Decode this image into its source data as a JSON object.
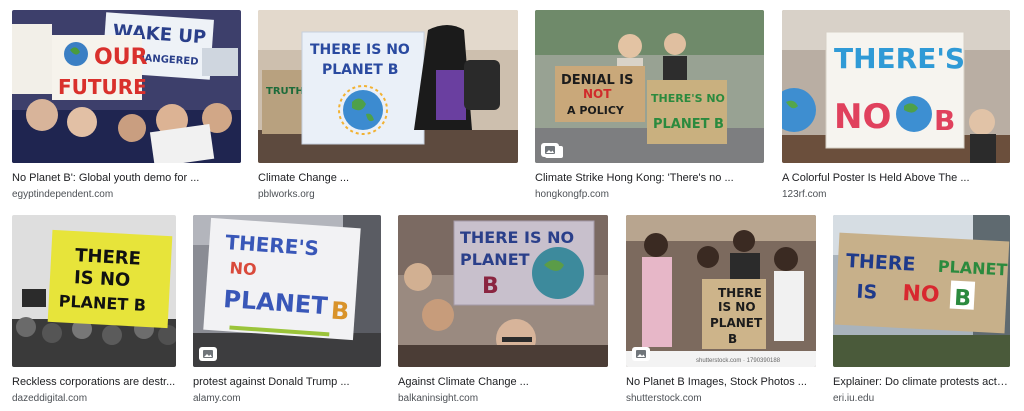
{
  "results": [
    {
      "title": "No Planet B': Global youth demo for ...",
      "source": "egyptindependent.com",
      "sign_lines": [
        "WAKE UP",
        "OUR",
        "FUTURE"
      ],
      "photo_bg": "#3d3f6b",
      "sign_color": "#f4f1ea",
      "text_color": "#d9302c",
      "icon": "image-icon"
    },
    {
      "title": "Climate Change ...",
      "source": "pblworks.org",
      "sign_lines": [
        "THERE IS NO",
        "PLANET B"
      ],
      "photo_bg": "#c9b9a6",
      "sign_color": "#eaf0f8",
      "text_color": "#2a4aa0",
      "icon": "image-icon"
    },
    {
      "title": "Climate Strike Hong Kong: 'There's no ...",
      "source": "hongkongfp.com",
      "sign_lines": [
        "DENIAL IS",
        "NOT",
        "A POLICY",
        "THERE'S NO",
        "PLANET B"
      ],
      "photo_bg": "#8f9a8a",
      "sign_color": "#c9a87a",
      "text_color": "#1c1c1c",
      "icon": "image-icon"
    },
    {
      "title": "A Colorful Poster Is Held Above The ...",
      "source": "123rf.com",
      "sign_lines": [
        "THERE'S",
        "NO",
        "B"
      ],
      "photo_bg": "#b9aea3",
      "sign_color": "#f6f4ef",
      "text_color": "#e0415d",
      "icon": "image-icon"
    },
    {
      "title": "Reckless corporations are destr...",
      "source": "dazeddigital.com",
      "sign_lines": [
        "THERE",
        "IS NO",
        "PLANET B"
      ],
      "photo_bg": "#d9d9d9",
      "sign_color": "#e7e43a",
      "text_color": "#111111",
      "icon": "image-icon"
    },
    {
      "title": "protest against Donald Trump ...",
      "source": "alamy.com",
      "sign_lines": [
        "THERE'S",
        "NO",
        "PLANET",
        "B"
      ],
      "photo_bg": "#8a8c94",
      "sign_color": "#f2f2f4",
      "text_color": "#3957b8",
      "icon": "image-icon"
    },
    {
      "title": "Against Climate Change ...",
      "source": "balkaninsight.com",
      "sign_lines": [
        "THERE IS NO",
        "PLANET",
        "B"
      ],
      "photo_bg": "#9a8a80",
      "sign_color": "#c8c0cc",
      "text_color": "#8a2540",
      "icon": "image-icon"
    },
    {
      "title": "No Planet B Images, Stock Photos ...",
      "source": "shutterstock.com",
      "sign_lines": [
        "THERE",
        "IS NO",
        "PLANET",
        "B"
      ],
      "photo_bg": "#7c6a5e",
      "sign_color": "#cdb48a",
      "text_color": "#1c1c1c",
      "watermark": "shutterstock.com · 1790390188",
      "icon": "image-icon"
    },
    {
      "title": "Explainer: Do climate protests actu...",
      "source": "eri.iu.edu",
      "sign_lines": [
        "THERE",
        "IS",
        "NO",
        "PLANET",
        "B"
      ],
      "photo_bg": "#a9b3bc",
      "sign_color": "#c7b08a",
      "text_color": "#1f3a8a",
      "icon": "image-icon"
    }
  ]
}
